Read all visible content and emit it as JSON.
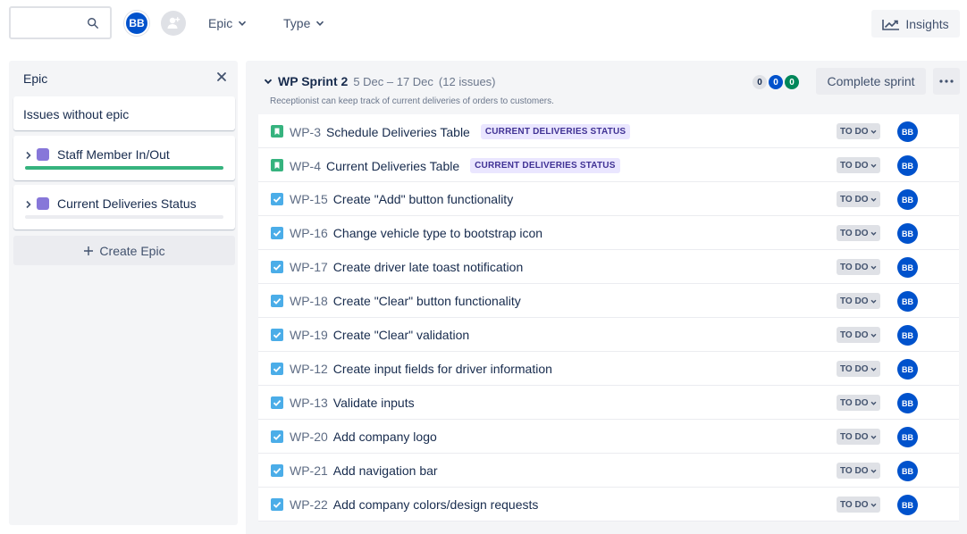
{
  "toolbar": {
    "search_placeholder": "",
    "user_initials": "BB",
    "epic_filter_label": "Epic",
    "type_filter_label": "Type",
    "insights_label": "Insights"
  },
  "epic_panel": {
    "title": "Epic",
    "issues_without_epic": "Issues without epic",
    "epics": [
      {
        "name": "Staff Member In/Out",
        "color": "#8777d9",
        "progress": 1.0
      },
      {
        "name": "Current Deliveries Status",
        "color": "#8777d9",
        "progress": 0.0
      }
    ],
    "create_label": "Create Epic"
  },
  "sprint": {
    "name": "WP Sprint 2",
    "dates": "5 Dec – 17 Dec",
    "count": "(12 issues)",
    "goal": "Receptionist can keep track of current deliveries of orders to customers.",
    "counts": {
      "todo": "0",
      "in_progress": "0",
      "done": "0"
    },
    "complete_label": "Complete sprint",
    "issues": [
      {
        "type": "story",
        "key": "WP-3",
        "summary": "Schedule Deliveries Table",
        "epic": "CURRENT DELIVERIES STATUS",
        "status": "TO DO",
        "assignee": "BB"
      },
      {
        "type": "story",
        "key": "WP-4",
        "summary": "Current Deliveries Table",
        "epic": "CURRENT DELIVERIES STATUS",
        "status": "TO DO",
        "assignee": "BB"
      },
      {
        "type": "task",
        "key": "WP-15",
        "summary": "Create \"Add\" button functionality",
        "epic": "",
        "status": "TO DO",
        "assignee": "BB"
      },
      {
        "type": "task",
        "key": "WP-16",
        "summary": "Change vehicle type to bootstrap icon",
        "epic": "",
        "status": "TO DO",
        "assignee": "BB"
      },
      {
        "type": "task",
        "key": "WP-17",
        "summary": "Create driver late toast notification",
        "epic": "",
        "status": "TO DO",
        "assignee": "BB"
      },
      {
        "type": "task",
        "key": "WP-18",
        "summary": "Create \"Clear\" button functionality",
        "epic": "",
        "status": "TO DO",
        "assignee": "BB"
      },
      {
        "type": "task",
        "key": "WP-19",
        "summary": "Create \"Clear\" validation",
        "epic": "",
        "status": "TO DO",
        "assignee": "BB"
      },
      {
        "type": "task",
        "key": "WP-12",
        "summary": "Create input fields for driver information",
        "epic": "",
        "status": "TO DO",
        "assignee": "BB"
      },
      {
        "type": "task",
        "key": "WP-13",
        "summary": "Validate inputs",
        "epic": "",
        "status": "TO DO",
        "assignee": "BB"
      },
      {
        "type": "task",
        "key": "WP-20",
        "summary": "Add company logo",
        "epic": "",
        "status": "TO DO",
        "assignee": "BB"
      },
      {
        "type": "task",
        "key": "WP-21",
        "summary": "Add navigation bar",
        "epic": "",
        "status": "TO DO",
        "assignee": "BB"
      },
      {
        "type": "task",
        "key": "WP-22",
        "summary": "Add company colors/design requests",
        "epic": "",
        "status": "TO DO",
        "assignee": "BB"
      }
    ]
  },
  "colors": {
    "brand_blue": "#0052cc",
    "story_green": "#36b37e",
    "task_blue": "#4bade8",
    "epic_purple": "#8777d9",
    "done_green": "#00875a"
  }
}
